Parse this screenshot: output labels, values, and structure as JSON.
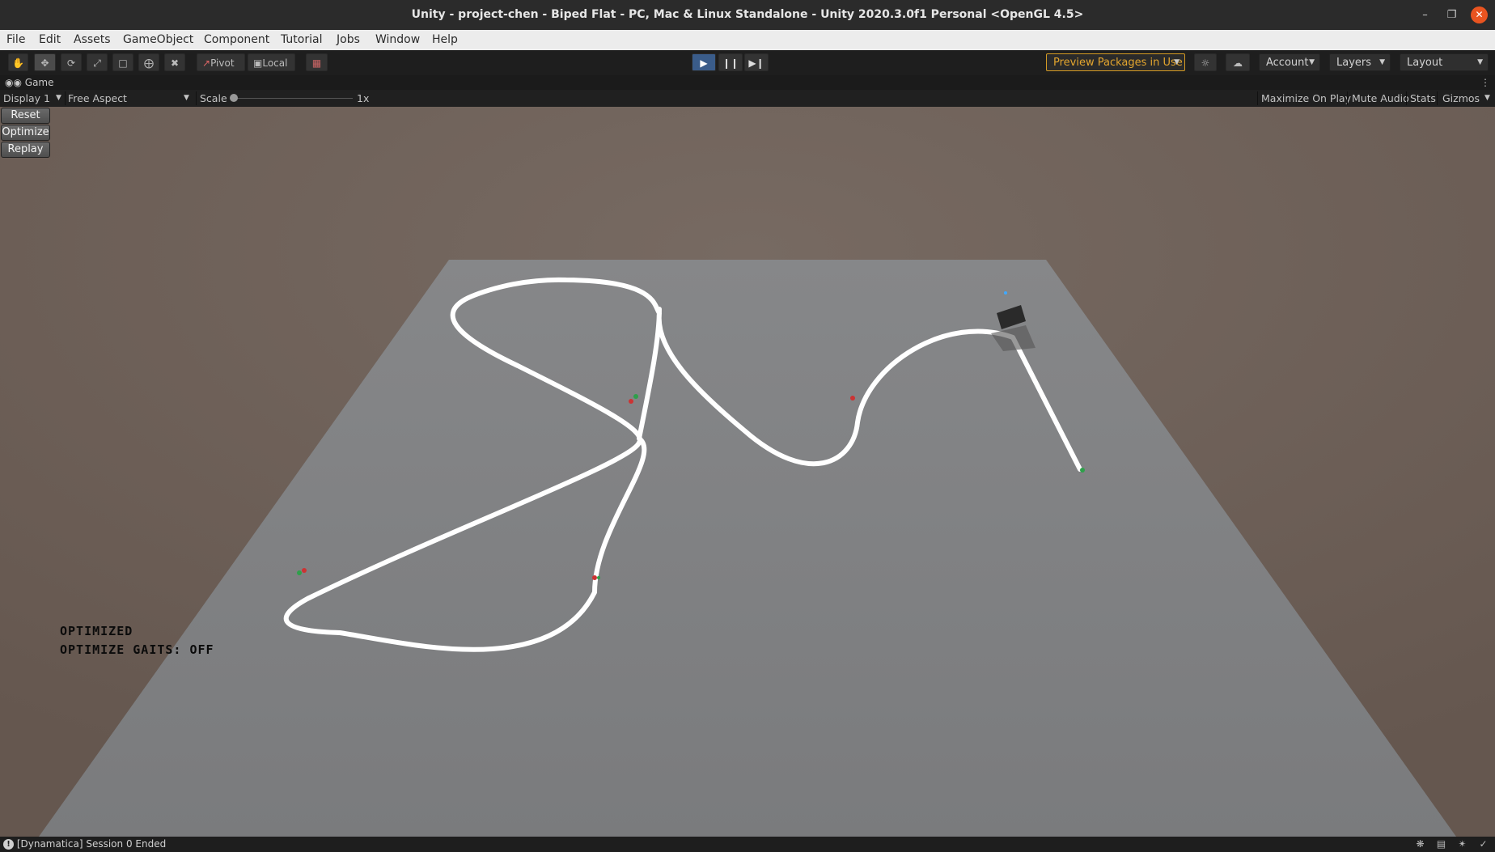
{
  "window": {
    "title": "Unity - project-chen - Biped Flat - PC, Mac & Linux Standalone - Unity 2020.3.0f1 Personal <OpenGL 4.5>",
    "controls": [
      "minimize-icon",
      "restore-icon",
      "close-icon"
    ]
  },
  "menu": {
    "items": [
      "File",
      "Edit",
      "Assets",
      "GameObject",
      "Component",
      "Tutorial",
      "Jobs",
      "Window",
      "Help"
    ]
  },
  "toolbar": {
    "tools": [
      "hand-tool-icon",
      "move-tool-icon",
      "rotate-tool-icon",
      "scale-tool-icon",
      "rect-tool-icon",
      "transform-tool-icon",
      "custom-tool-icon"
    ],
    "pivot_label": "Pivot",
    "local_label": "Local",
    "preview_packages": "Preview Packages in Use",
    "account": "Account",
    "layers": "Layers",
    "layout": "Layout"
  },
  "game_tab": {
    "label": "Game"
  },
  "game_bar": {
    "display": "Display 1",
    "aspect": "Free Aspect",
    "scale_label": "Scale",
    "scale_value": "1x",
    "maximize": "Maximize On Play",
    "mute": "Mute Audio",
    "stats": "Stats",
    "gizmos": "Gizmos"
  },
  "viewport": {
    "buttons": [
      "Reset",
      "Optimize",
      "Replay"
    ],
    "status_lines": [
      "OPTIMIZED",
      "OPTIMIZE GAITS: OFF"
    ],
    "colors": {
      "sky_top": "#6d6259",
      "sky_bottom": "#6a5a52",
      "plane": "#7b7c7e",
      "path": "#ffffff"
    }
  },
  "statusbar": {
    "message": "[Dynamatica] Session 0 Ended"
  }
}
